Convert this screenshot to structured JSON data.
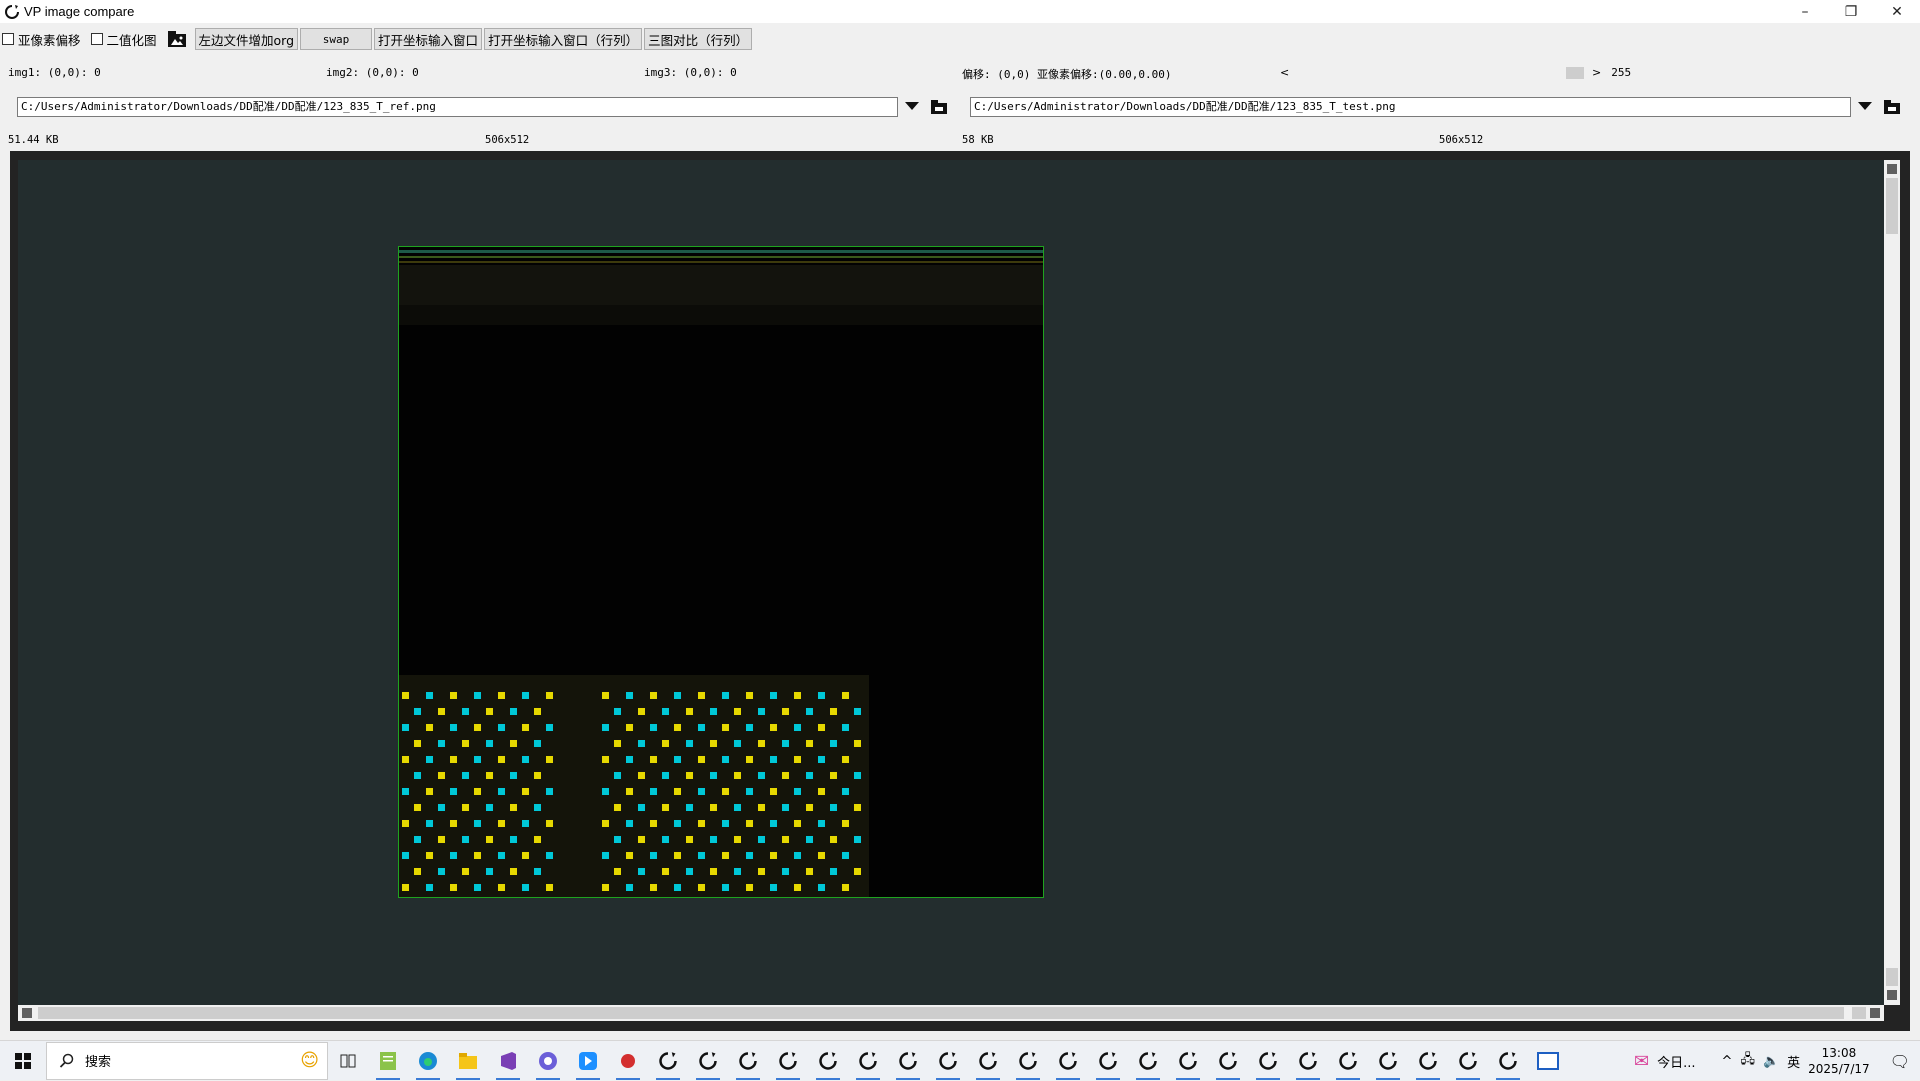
{
  "window": {
    "title": "VP image compare",
    "minimize": "–",
    "restore": "❐",
    "close": "✕"
  },
  "toolbar": {
    "subpixel_label": "亚像素偏移",
    "binarize_label": "二值化图",
    "add_org_label": "左边文件增加org",
    "swap_label": "swap",
    "open_coord_label": "打开坐标输入窗口",
    "open_coord_rowcol_label": "打开坐标输入窗口（行列）",
    "three_compare_label": "三图对比（行列）"
  },
  "info": {
    "img1": "img1: (0,0): 0",
    "img2": "img2: (0,0): 0",
    "img3": "img3: (0,0): 0",
    "offset": "偏移: (0,0) 亚像素偏移:(0.00,0.00)",
    "slider_left": "<",
    "slider_right": ">",
    "slider_value": "255",
    "slider_level": 1.0
  },
  "left_file": {
    "path": "C:/Users/Administrator/Downloads/DD配准/DD配准/123_835_T_ref.png",
    "size": "51.44 KB",
    "dims": "506x512"
  },
  "right_file": {
    "path": "C:/Users/Administrator/Downloads/DD配准/DD配准/123_835_T_test.png",
    "size": "58 KB",
    "dims": "506x512"
  },
  "taskbar": {
    "search_placeholder": "搜索",
    "tray_text": "今日...",
    "ime": "英",
    "time": "13:08",
    "date": "2025/7/17"
  },
  "colors": {
    "canvas_bg": "#232d2e",
    "image_border": "#1fa31f",
    "dot_yellow": "#e6d800",
    "dot_cyan": "#00c8d8"
  }
}
